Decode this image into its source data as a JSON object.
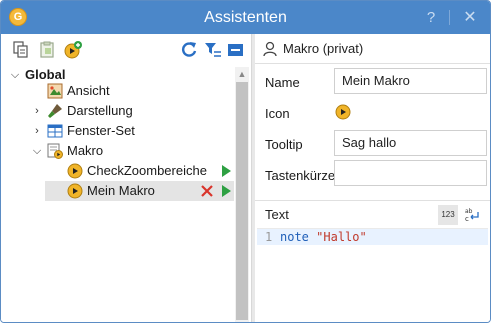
{
  "window": {
    "title": "Assistenten",
    "app_icon_letter": "G",
    "help_glyph": "?",
    "close_glyph": "✕"
  },
  "tree": {
    "root_label": "Global",
    "items": [
      {
        "label": "Ansicht"
      },
      {
        "label": "Darstellung"
      },
      {
        "label": "Fenster-Set"
      },
      {
        "label": "Makro"
      },
      {
        "label": "CheckZoombereiche"
      },
      {
        "label": "Mein Makro"
      }
    ]
  },
  "detail": {
    "header_title": "Makro (privat)",
    "name_label": "Name",
    "name_value": "Mein Makro",
    "icon_label": "Icon",
    "tooltip_label": "Tooltip",
    "tooltip_value": "Sag hallo",
    "shortcut_label": "Tastenkürzel",
    "shortcut_value": "",
    "text_label": "Text",
    "numbers_button": "123",
    "editor": {
      "line_number": "1",
      "keyword": "note",
      "string": "\"Hallo\""
    }
  },
  "colors": {
    "titlebar": "#4b87c9",
    "accent_green": "#2ea043",
    "delete_red": "#d9342b",
    "macro_icon": "#f0b429"
  }
}
